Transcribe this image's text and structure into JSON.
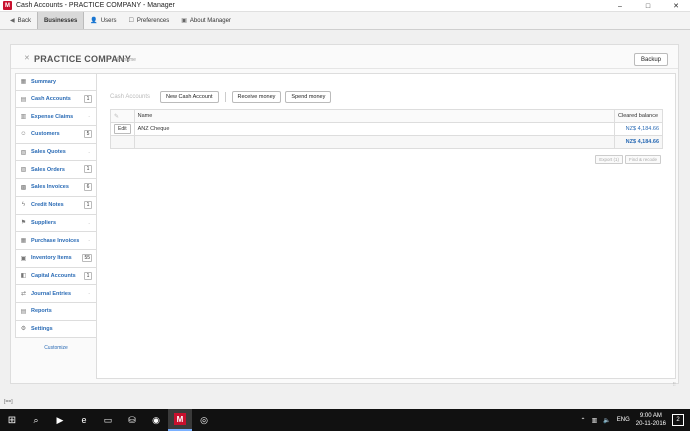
{
  "window": {
    "title": "Cash Accounts - PRACTICE COMPANY - Manager",
    "app_logo": "M",
    "controls": [
      "–",
      "□",
      "✕"
    ]
  },
  "toolbar": {
    "back": "Back",
    "businesses": "Businesses",
    "users": "Users",
    "preferences": "Preferences",
    "about": "About Manager"
  },
  "header": {
    "company": "PRACTICE COMPANY",
    "rename": "Rename",
    "backup": "Backup"
  },
  "sidebar": {
    "items": [
      {
        "label": "Summary",
        "icon": "summary-icon",
        "count": ""
      },
      {
        "label": "Cash Accounts",
        "icon": "bank-icon",
        "count": "1"
      },
      {
        "label": "Expense Claims",
        "icon": "expense-icon",
        "count": "-"
      },
      {
        "label": "Customers",
        "icon": "customers-icon",
        "count": "5"
      },
      {
        "label": "Sales Quotes",
        "icon": "quote-icon",
        "count": "-"
      },
      {
        "label": "Sales Orders",
        "icon": "order-icon",
        "count": "1"
      },
      {
        "label": "Sales Invoices",
        "icon": "invoice-icon",
        "count": "6"
      },
      {
        "label": "Credit Notes",
        "icon": "credit-icon",
        "count": "1"
      },
      {
        "label": "Suppliers",
        "icon": "suppliers-icon",
        "count": "-"
      },
      {
        "label": "Purchase Invoices",
        "icon": "purchase-icon",
        "count": "-"
      },
      {
        "label": "Inventory Items",
        "icon": "inventory-icon",
        "count": "55"
      },
      {
        "label": "Capital Accounts",
        "icon": "capital-icon",
        "count": "1"
      },
      {
        "label": "Journal Entries",
        "icon": "journal-icon",
        "count": "-"
      },
      {
        "label": "Reports",
        "icon": "reports-icon",
        "count": ""
      },
      {
        "label": "Settings",
        "icon": "settings-icon",
        "count": ""
      }
    ],
    "customize": "Customize"
  },
  "content": {
    "section_label": "Cash Accounts",
    "new_account": "New Cash Account",
    "receive_money": "Receive money",
    "spend_money": "Spend money",
    "columns": {
      "name": "Name",
      "balance": "Cleared balance"
    },
    "rows": [
      {
        "edit": "Edit",
        "name": "ANZ Cheque",
        "balance": "NZ$ 4,184.66"
      }
    ],
    "total": "NZ$ 4,184.66",
    "export": "Export (1)",
    "find_recode": "Find & recode"
  },
  "status": {
    "left": "[==]"
  },
  "taskbar": {
    "lang": "ENG",
    "time": "9:00 AM",
    "date": "20-11-2016",
    "notifications": "2"
  }
}
